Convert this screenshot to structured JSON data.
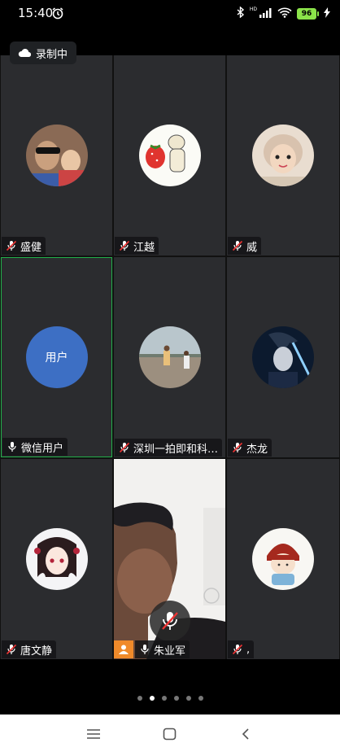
{
  "status_bar": {
    "time": "15:40",
    "battery": "96"
  },
  "recording": {
    "label": "录制中"
  },
  "participants": [
    {
      "name": "盛健",
      "muted": true
    },
    {
      "name": "江越",
      "muted": true
    },
    {
      "name": "威",
      "muted": true
    },
    {
      "name": "微信用户",
      "muted": false,
      "avatar_text": "用户",
      "speaking": true
    },
    {
      "name": "深圳一拍即和科…",
      "muted": true
    },
    {
      "name": "杰龙",
      "muted": true
    },
    {
      "name": "唐文静",
      "muted": true
    },
    {
      "name": "朱业军",
      "muted": false,
      "video_on": true
    },
    {
      "name": ",",
      "muted": true
    }
  ],
  "pagination": {
    "total": 6,
    "current": 2
  },
  "nav": {
    "menu": "menu-icon",
    "home": "home-icon",
    "back": "back-icon"
  },
  "colors": {
    "active_border": "#22b04b",
    "avatar_blue": "#3d6fc4",
    "tile_bg": "#2b2c2f",
    "badge_orange": "#f08a2a"
  }
}
